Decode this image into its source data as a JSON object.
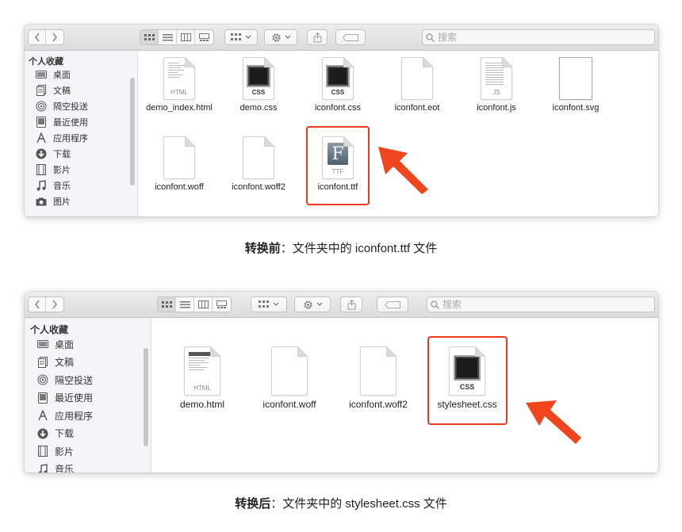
{
  "toolbar": {
    "search_placeholder": "搜索"
  },
  "sidebar": {
    "heading": "个人收藏",
    "items": [
      {
        "label": "桌面",
        "icon": "desktop-icon"
      },
      {
        "label": "文稿",
        "icon": "documents-icon"
      },
      {
        "label": "隔空投送",
        "icon": "airdrop-icon"
      },
      {
        "label": "最近使用",
        "icon": "recents-icon"
      },
      {
        "label": "应用程序",
        "icon": "applications-icon"
      },
      {
        "label": "下载",
        "icon": "downloads-icon"
      },
      {
        "label": "影片",
        "icon": "movies-icon"
      },
      {
        "label": "音乐",
        "icon": "music-icon"
      },
      {
        "label": "图片",
        "icon": "pictures-icon"
      }
    ]
  },
  "before": {
    "files": [
      {
        "name": "demo_index.html",
        "type": "html",
        "label": "HTML"
      },
      {
        "name": "demo.css",
        "type": "css",
        "label": "CSS"
      },
      {
        "name": "iconfont.css",
        "type": "css",
        "label": "CSS"
      },
      {
        "name": "iconfont.eot",
        "type": "blank",
        "label": ""
      },
      {
        "name": "iconfont.js",
        "type": "js",
        "label": "JS"
      },
      {
        "name": "iconfont.svg",
        "type": "svg",
        "label": ""
      },
      {
        "name": "iconfont.woff",
        "type": "blank",
        "label": ""
      },
      {
        "name": "iconfont.woff2",
        "type": "blank",
        "label": ""
      },
      {
        "name": "iconfont.ttf",
        "type": "ttf",
        "label": "TTF",
        "glyph": "F"
      }
    ],
    "caption_bold": "转换前",
    "caption_rest": "：文件夹中的 iconfont.ttf 文件"
  },
  "after": {
    "files": [
      {
        "name": "demo.html",
        "type": "html",
        "label": "HTML"
      },
      {
        "name": "iconfont.woff",
        "type": "blank",
        "label": ""
      },
      {
        "name": "iconfont.woff2",
        "type": "blank",
        "label": ""
      },
      {
        "name": "stylesheet.css",
        "type": "css",
        "label": "CSS"
      }
    ],
    "caption_bold": "转换后",
    "caption_rest": "：文件夹中的 stylesheet.css 文件"
  },
  "colors": {
    "highlight": "#e83a1c",
    "arrow": "#f0461e"
  }
}
